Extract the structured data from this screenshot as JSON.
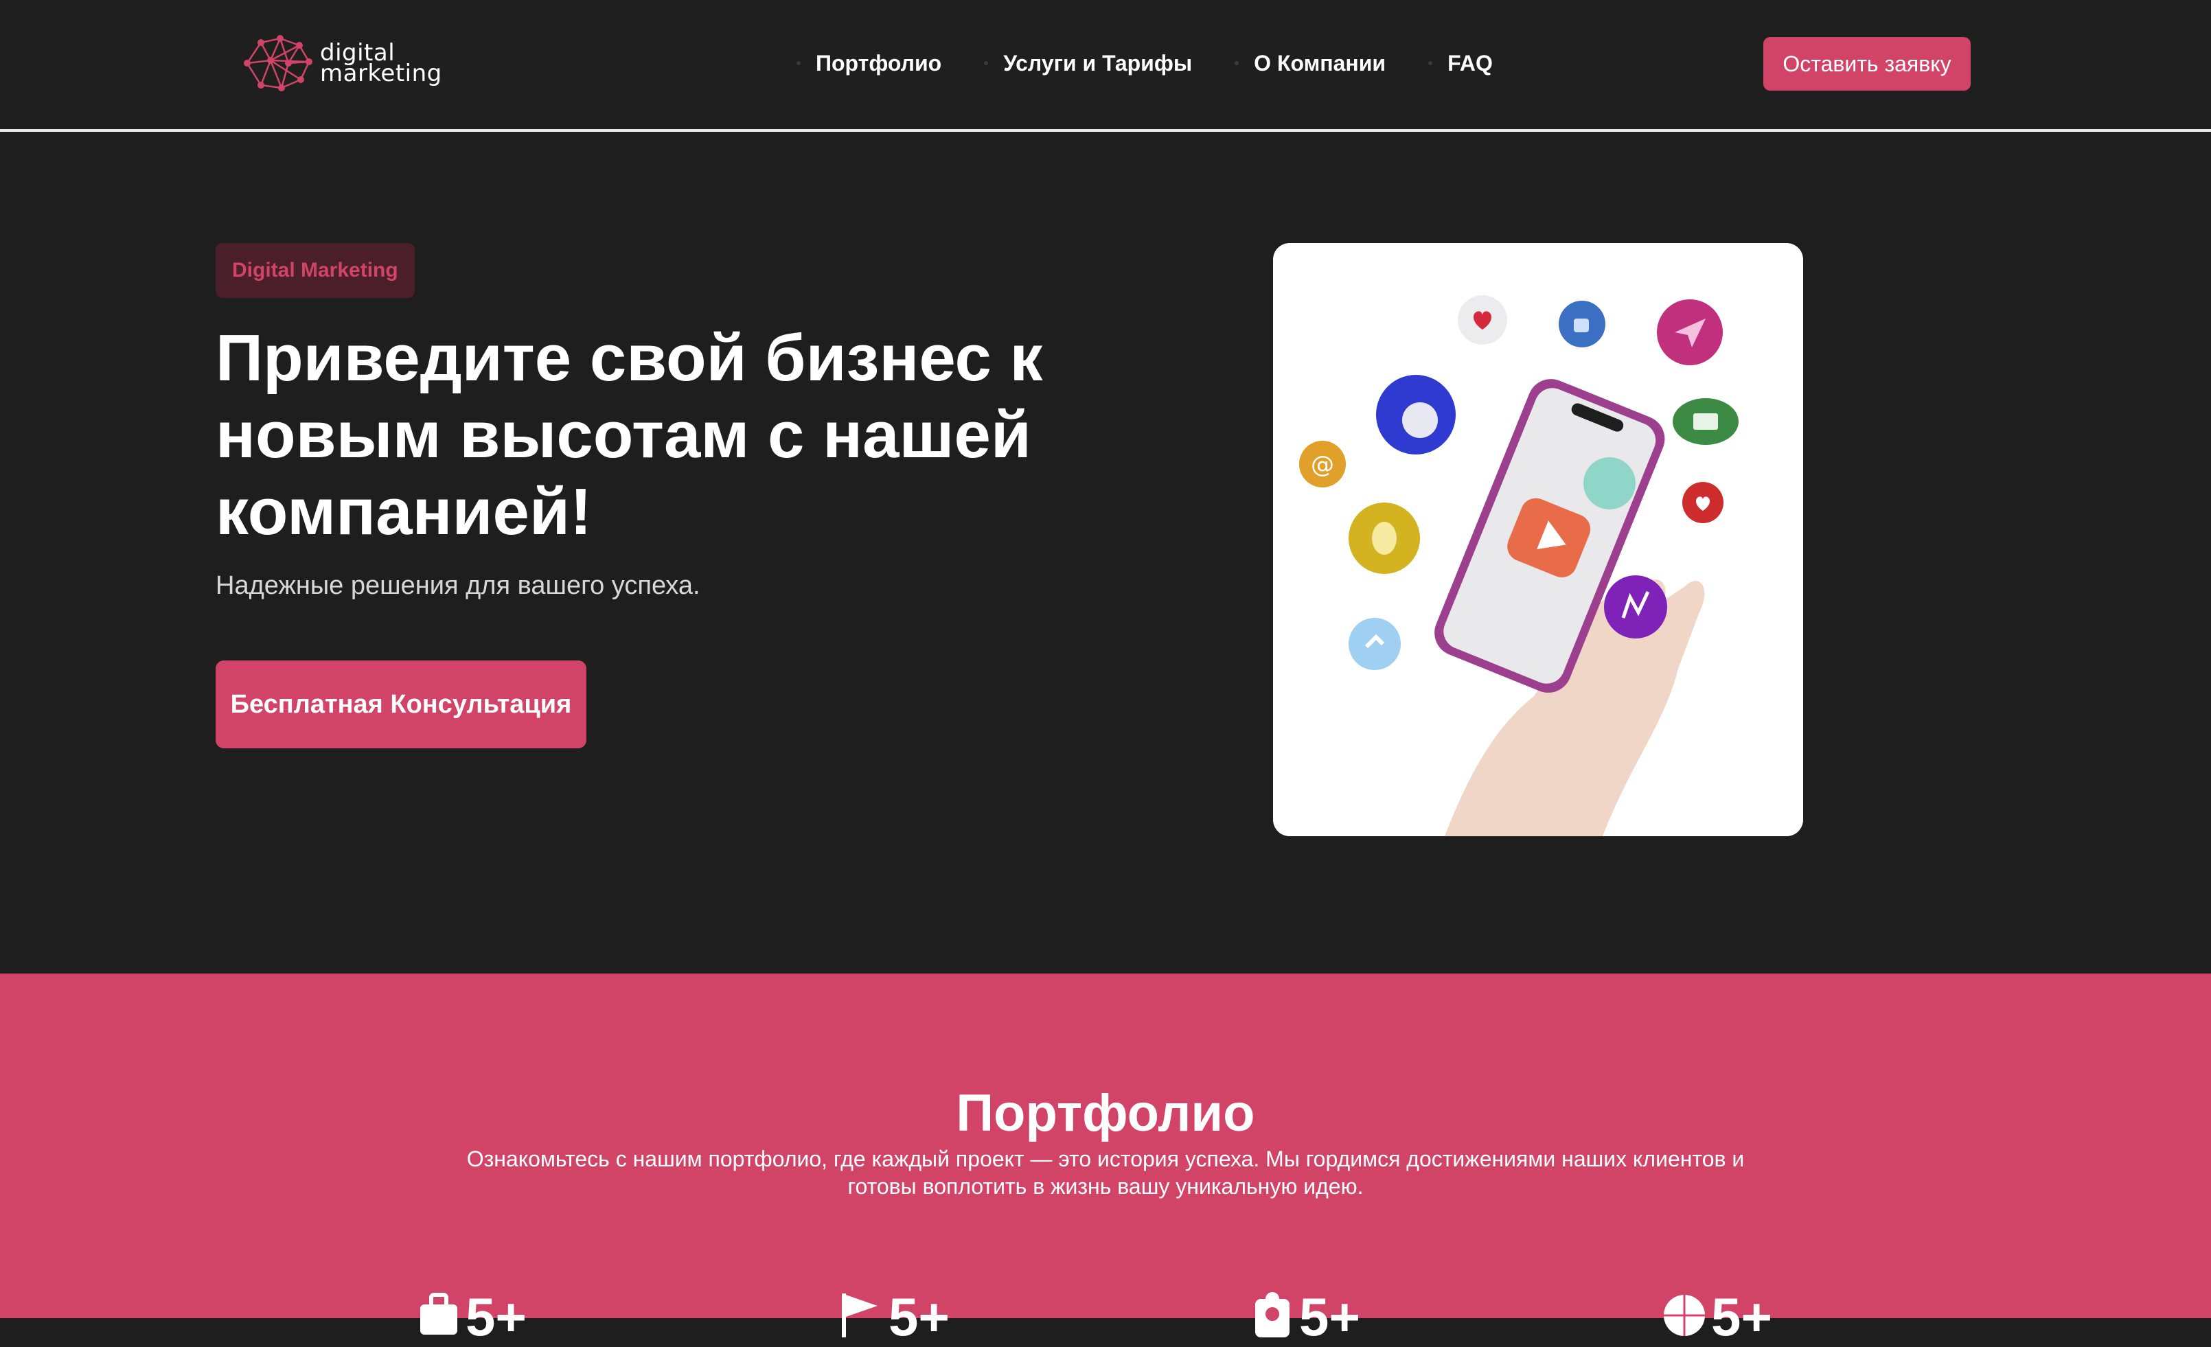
{
  "header": {
    "logo_line1": "digital",
    "logo_line2": "marketing",
    "nav": [
      {
        "label": "Портфолио"
      },
      {
        "label": "Услуги и Тарифы"
      },
      {
        "label": "О Компании"
      },
      {
        "label": "FAQ"
      }
    ],
    "cta_label": "Оставить заявку"
  },
  "hero": {
    "badge": "Digital Marketing",
    "title": "Приведите свой бизнес к новым высотам с нашей компанией!",
    "subtitle": "Надежные решения для вашего успеха.",
    "button_label": "Бесплатная Консультация"
  },
  "portfolio": {
    "title": "Портфолио",
    "text": "Ознакомьтесь с нашим портфолио, где каждый проект — это история успеха. Мы гордимся достижениями наших клиентов и готовы воплотить в жизнь вашу уникальную идею.",
    "stats": [
      {
        "icon": "briefcase-icon",
        "value": "5+"
      },
      {
        "icon": "flag-icon",
        "value": "5+"
      },
      {
        "icon": "badge-icon",
        "value": "5+"
      },
      {
        "icon": "globe-icon",
        "value": "5+"
      }
    ]
  },
  "colors": {
    "accent": "#d24467",
    "dark_bg": "#1e1e1f",
    "badge_bg": "#4a1f2a"
  }
}
